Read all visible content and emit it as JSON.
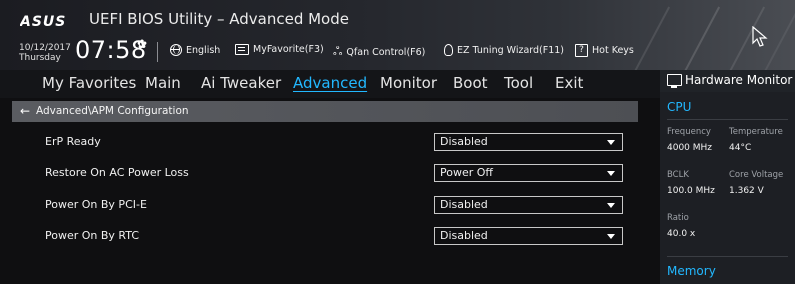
{
  "header": {
    "app_title": "UEFI BIOS Utility – Advanced Mode",
    "date": "10/12/2017",
    "day": "Thursday",
    "time": "07:58",
    "toolbar": [
      {
        "icon": "globe-icon",
        "label": "English"
      },
      {
        "icon": "my-favorite-icon",
        "label": "MyFavorite(F3)"
      },
      {
        "icon": "fan-icon",
        "label": "Qfan Control(F6)"
      },
      {
        "icon": "lightbulb-icon",
        "label": "EZ Tuning Wizard(F11)"
      },
      {
        "icon": "question-icon",
        "label": "Hot Keys"
      }
    ]
  },
  "nav": {
    "tabs": [
      "My Favorites",
      "Main",
      "Ai Tweaker",
      "Advanced",
      "Monitor",
      "Boot",
      "Tool",
      "Exit"
    ],
    "active": "Advanced"
  },
  "main": {
    "breadcrumb": "Advanced\\APM Configuration",
    "settings": [
      {
        "label": "ErP Ready",
        "value": "Disabled"
      },
      {
        "label": "Restore On AC Power Loss",
        "value": "Power Off"
      },
      {
        "label": "Power On By PCI-E",
        "value": "Disabled"
      },
      {
        "label": "Power On By RTC",
        "value": "Disabled"
      }
    ]
  },
  "hardware_monitor": {
    "title": "Hardware Monitor",
    "cpu": {
      "heading": "CPU",
      "frequency_label": "Frequency",
      "frequency_value": "4000 MHz",
      "temperature_label": "Temperature",
      "temperature_value": "44°C",
      "bclk_label": "BCLK",
      "bclk_value": "100.0 MHz",
      "core_voltage_label": "Core Voltage",
      "core_voltage_value": "1.362 V",
      "ratio_label": "Ratio",
      "ratio_value": "40.0 x"
    },
    "memory": {
      "heading": "Memory"
    }
  },
  "colors": {
    "accent": "#22b8ff",
    "breadcrumb_bg": "#5a5c61",
    "background": "#0f0f11"
  }
}
